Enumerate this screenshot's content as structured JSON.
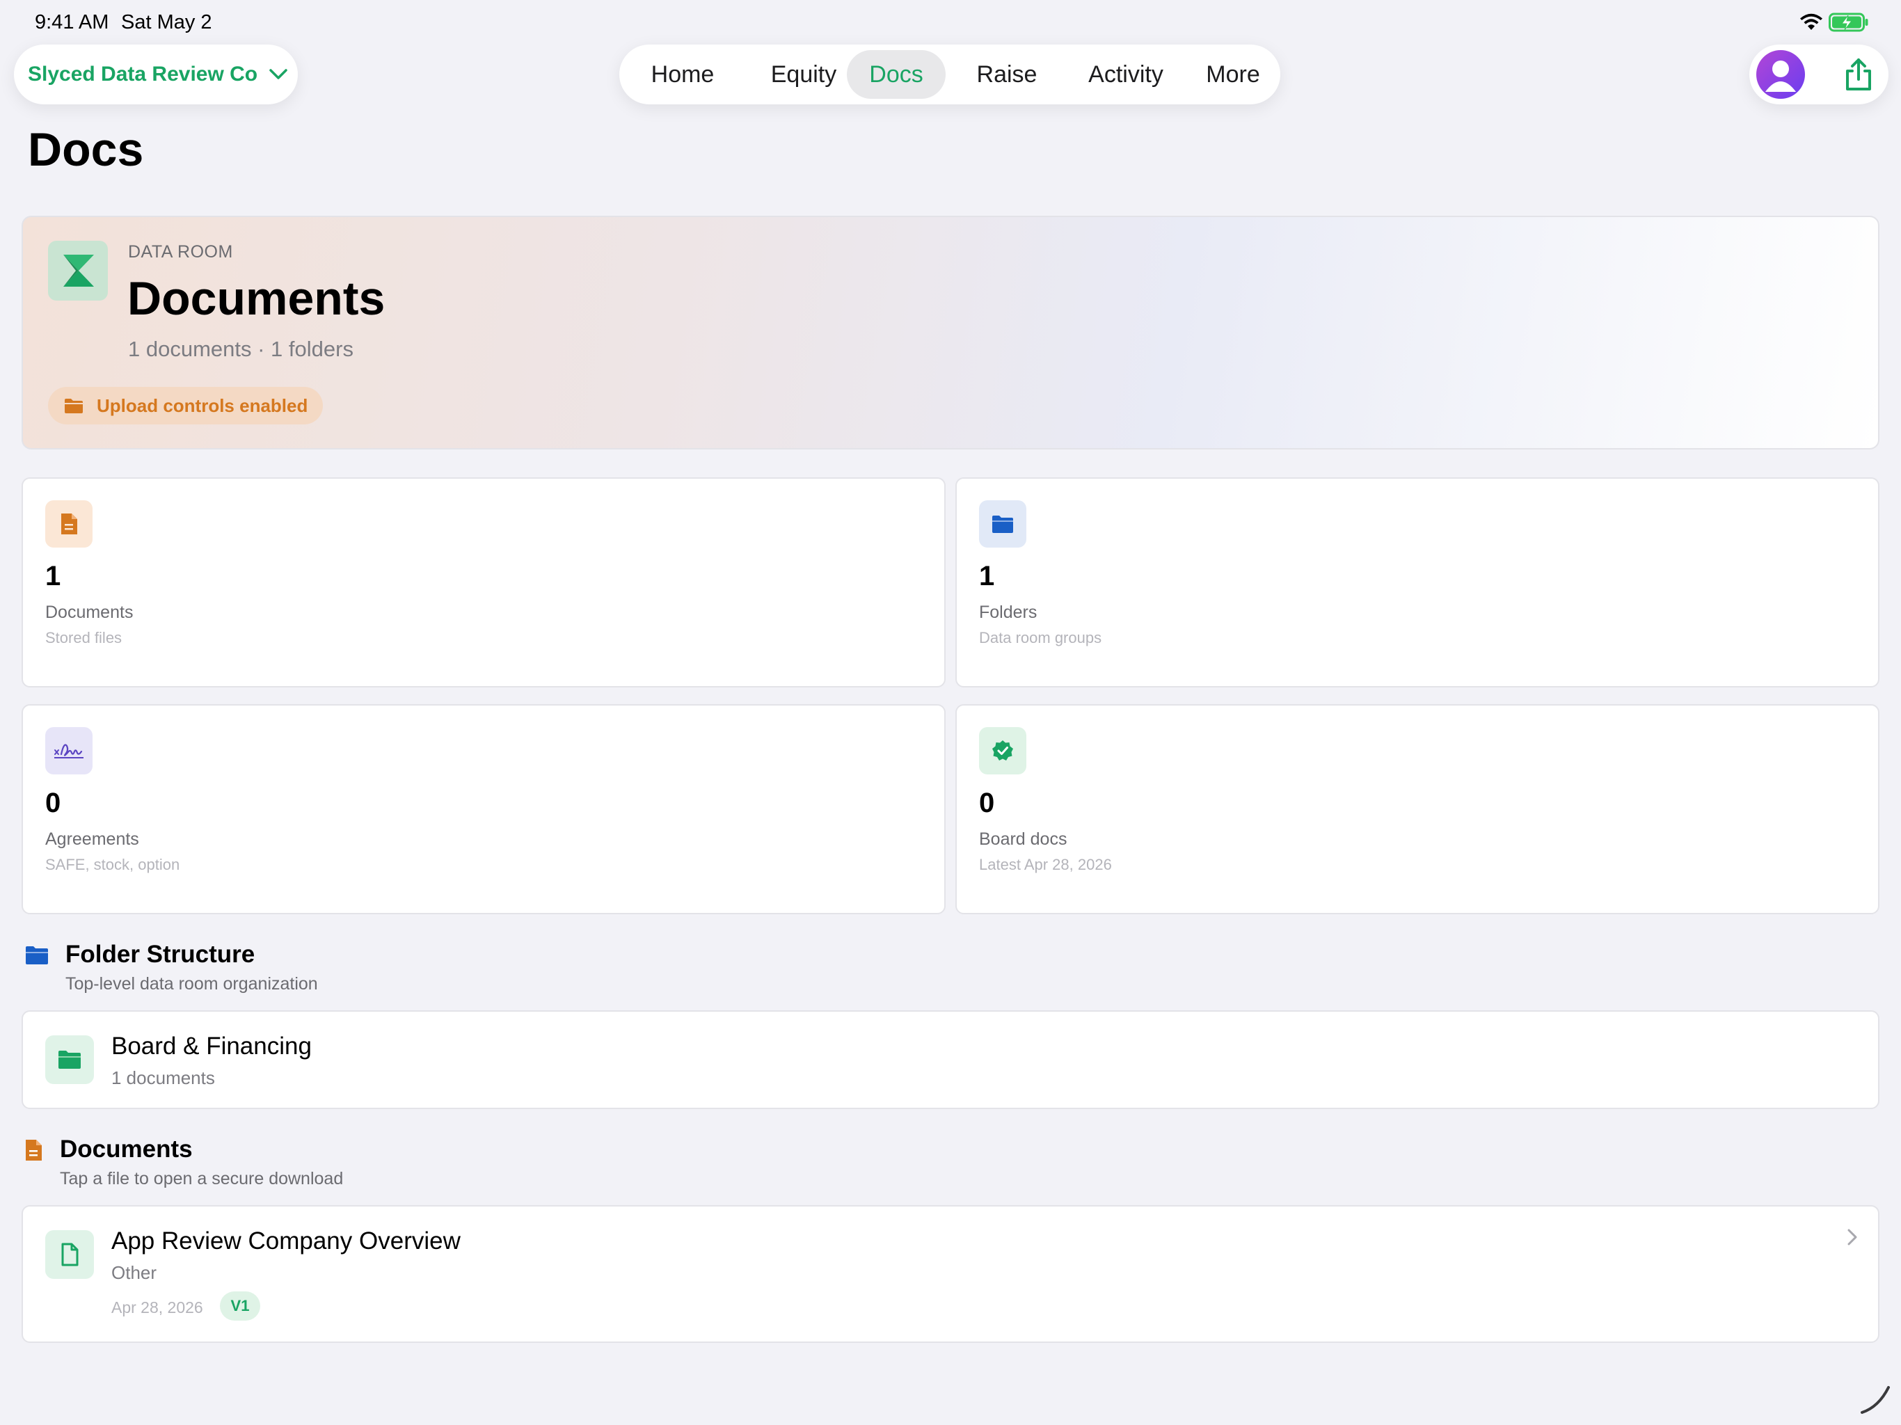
{
  "status_bar": {
    "time": "9:41 AM",
    "date": "Sat May 2"
  },
  "company_switcher": {
    "name": "Slyced Data Review Co"
  },
  "nav": {
    "tabs": [
      {
        "label": "Home",
        "active": false
      },
      {
        "label": "Equity",
        "active": false
      },
      {
        "label": "Docs",
        "active": true
      },
      {
        "label": "Raise",
        "active": false
      },
      {
        "label": "Activity",
        "active": false
      },
      {
        "label": "More",
        "active": false
      }
    ]
  },
  "page_title": "Docs",
  "hero": {
    "kicker": "DATA ROOM",
    "title": "Documents",
    "subtitle": "1 documents · 1 folders",
    "badge": "Upload controls enabled"
  },
  "stats": [
    {
      "icon": "document-icon",
      "value": "1",
      "label": "Documents",
      "caption": "Stored files",
      "color": "#d5781f"
    },
    {
      "icon": "folder-icon",
      "value": "1",
      "label": "Folders",
      "caption": "Data room groups",
      "color": "#1a5fc6"
    },
    {
      "icon": "signature-icon",
      "value": "0",
      "label": "Agreements",
      "caption": "SAFE, stock, option",
      "color": "#5b45c2"
    },
    {
      "icon": "verified-badge-icon",
      "value": "0",
      "label": "Board docs",
      "caption": "Latest Apr 28, 2026",
      "color": "#19a463"
    }
  ],
  "folder_section": {
    "title": "Folder Structure",
    "subtitle": "Top-level data room organization",
    "folders": [
      {
        "name": "Board & Financing",
        "count": "1 documents"
      }
    ]
  },
  "documents_section": {
    "title": "Documents",
    "subtitle": "Tap a file to open a secure download",
    "documents": [
      {
        "name": "App Review Company Overview",
        "category": "Other",
        "date": "Apr 28, 2026",
        "version": "V1"
      }
    ]
  },
  "colors": {
    "accent": "#19a463",
    "orange": "#d5781f",
    "blue": "#1a5fc6",
    "purple": "#5b45c2",
    "background": "#f2f2f7"
  }
}
